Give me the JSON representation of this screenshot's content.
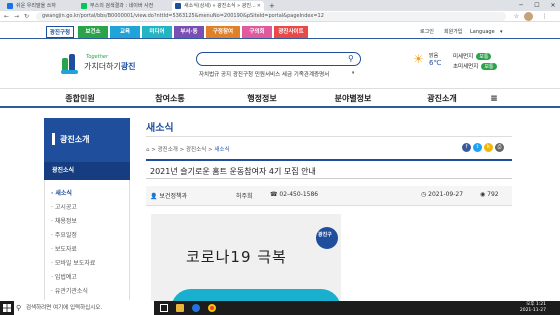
{
  "browser": {
    "tabs": [
      {
        "label": "쉬운 우리말을 쓰자",
        "favicon_color": "#1a73e8"
      },
      {
        "label": "부스의 검색결과 : 네이버 사전",
        "favicon_color": "#03c75a"
      },
      {
        "label": "새소식(상세) » 광진소식 » 광진...",
        "favicon_color": "#1f4e9c"
      }
    ],
    "new_tab_label": "+",
    "url": "gwangjin.go.kr/portal/bbs/B0000001/view.do?nttId=5363125&menuNo=200190&pSiteId=portal&pageIndex=12"
  },
  "topnav": {
    "sites": [
      {
        "label": "광진구청",
        "bg": "#ffffff",
        "color": "#1f4e9c"
      },
      {
        "label": "보건소",
        "bg": "#2aa34a",
        "color": "#ffffff"
      },
      {
        "label": "교육",
        "bg": "#1fa3d8",
        "color": "#ffffff"
      },
      {
        "label": "미디어",
        "bg": "#24b4c4",
        "color": "#ffffff"
      },
      {
        "label": "부서·동",
        "bg": "#7a4fb3",
        "color": "#ffffff"
      },
      {
        "label": "구정참여",
        "bg": "#e0812a",
        "color": "#ffffff"
      },
      {
        "label": "구의회",
        "bg": "#e05a9e",
        "color": "#ffffff"
      },
      {
        "label": "광진사이트",
        "bg": "#e84a4a",
        "color": "#ffffff"
      }
    ],
    "links": [
      "로그인",
      "회원가입",
      "Language"
    ]
  },
  "header": {
    "logo_small": "Together",
    "logo_main": "가치더하기",
    "logo_strong": "광진",
    "keywords": "자치법규  공지  광진구청  민원서비스  세금  기족관계증명서",
    "weather_label": "맑음",
    "temperature": "6℃",
    "dust": [
      {
        "label": "미세먼지",
        "status": "보통"
      },
      {
        "label": "초미세먼지",
        "status": "보통"
      }
    ]
  },
  "mainmenu": [
    "종합민원",
    "참여소통",
    "행정정보",
    "분야별정보",
    "광진소개"
  ],
  "sidebar": {
    "title": "광진소개",
    "section": "광진소식",
    "items": [
      "새소식",
      "고시공고",
      "채용정보",
      "주요일정",
      "보도자료",
      "모바일 보도자료",
      "입법예고",
      "유관기관소식"
    ]
  },
  "content": {
    "title": "새소식",
    "breadcrumb": [
      "광진소개",
      "광진소식",
      "새소식"
    ],
    "post_title": "2021년 슬기로운 홈트 운동참여자 4기 모집 안내",
    "department": "보건정책과",
    "author": "허주희",
    "phone": "02-450-1586",
    "date": "2021-09-27",
    "views": "792",
    "poster_logo": "광진구",
    "poster_text": "코로나19 극복",
    "share_colors": [
      "#3b5998",
      "#1da1f2",
      "#f2b705",
      "#666666"
    ]
  },
  "taskbar": {
    "search_placeholder": "검색하려면 여기에 입력하십시오.",
    "time": "오후 1:21",
    "date": "2021-11-27"
  }
}
